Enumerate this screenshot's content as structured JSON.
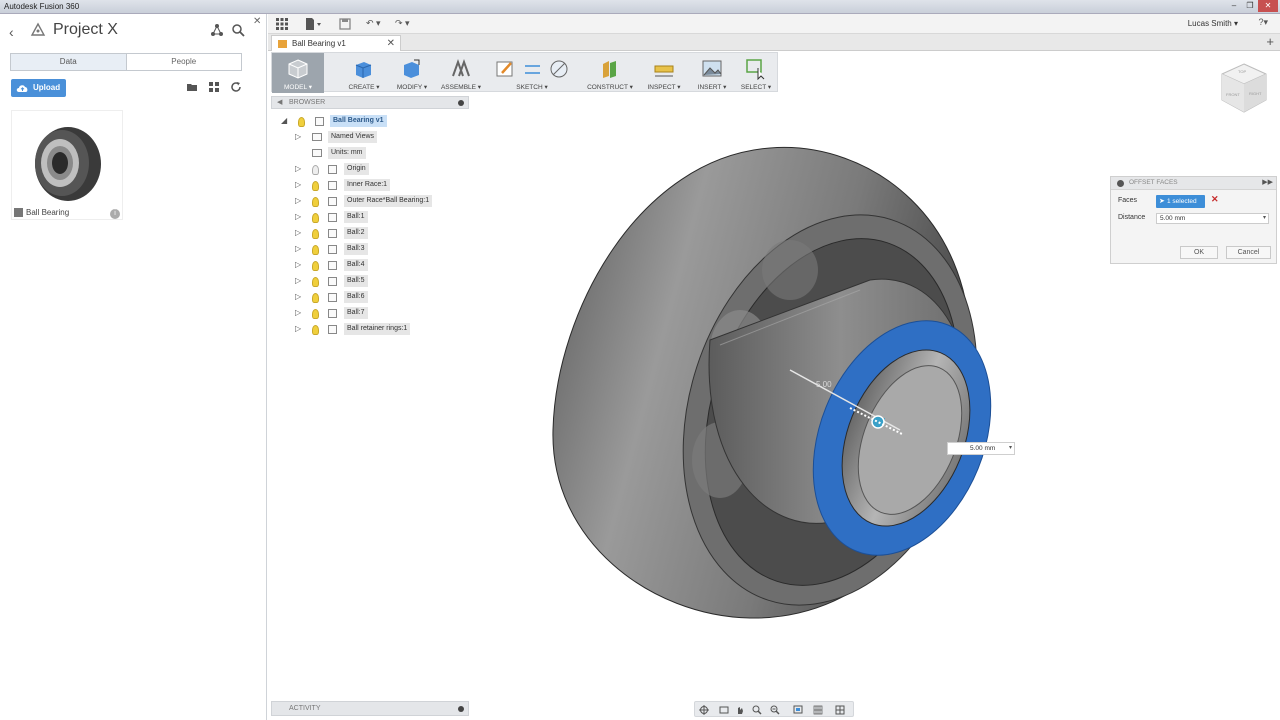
{
  "window": {
    "title": "Autodesk Fusion 360",
    "controls": [
      "–",
      "❐",
      "✕"
    ]
  },
  "data_panel": {
    "project_name": "Project X",
    "tabs": [
      {
        "label": "Data",
        "active": true
      },
      {
        "label": "People",
        "active": false
      }
    ],
    "upload_label": "Upload",
    "files": [
      {
        "name": "Ball Bearing"
      }
    ]
  },
  "app_bar": {
    "user_name": "Lucas Smith ▾",
    "help_label": "?▾"
  },
  "document_tab": {
    "label": "Ball Bearing v1"
  },
  "toolbar": {
    "workspace": "MODEL ▾",
    "groups": [
      "CREATE ▾",
      "MODIFY ▾",
      "ASSEMBLE ▾",
      "SKETCH ▾",
      "CONSTRUCT ▾",
      "INSPECT ▾",
      "INSERT ▾",
      "SELECT ▾"
    ]
  },
  "browser": {
    "title": "BROWSER",
    "root": "Ball Bearing v1",
    "items": [
      "Named Views",
      "Units: mm",
      "Origin",
      "Inner Race:1",
      "Outer Race*Ball Bearing:1",
      "Ball:1",
      "Ball:2",
      "Ball:3",
      "Ball:4",
      "Ball:5",
      "Ball:6",
      "Ball:7",
      "Ball retainer rings:1"
    ]
  },
  "viewcube": {
    "top": "TOP",
    "front": "FRONT",
    "right": "RIGHT"
  },
  "offset_dialog": {
    "title": "OFFSET FACES",
    "faces_label": "Faces",
    "selection": "1 selected",
    "distance_label": "Distance",
    "distance_value": "5.00 mm",
    "ok_label": "OK",
    "cancel_label": "Cancel"
  },
  "viewport": {
    "dimension_label": "5.00",
    "dimension_input": "5.00 mm"
  },
  "activity": {
    "title": "ACTIVITY"
  },
  "colors": {
    "accent": "#3d8ed8",
    "selected_face": "#2f6fc4",
    "upload": "#4a90d9"
  }
}
